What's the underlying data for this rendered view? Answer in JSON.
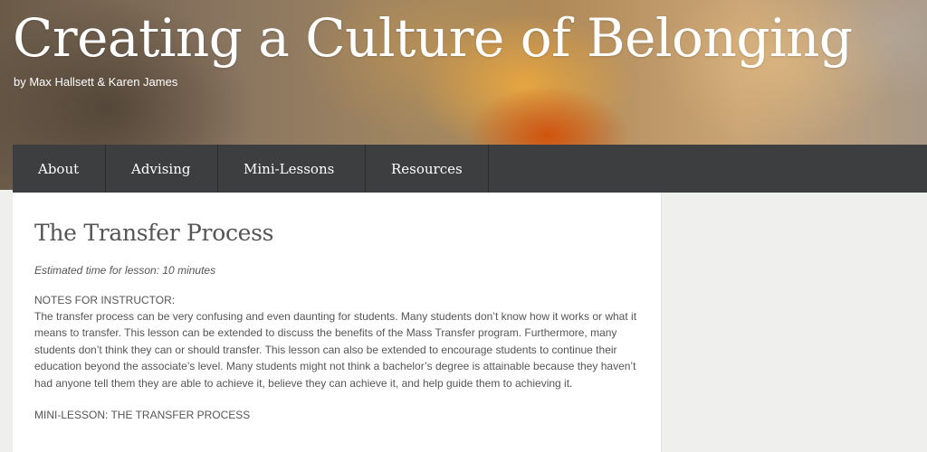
{
  "site": {
    "title": "Creating a Culture of Belonging",
    "byline": "by Max Hallsett & Karen James"
  },
  "nav": {
    "items": [
      {
        "label": "About"
      },
      {
        "label": "Advising"
      },
      {
        "label": "Mini-Lessons"
      },
      {
        "label": "Resources"
      }
    ]
  },
  "post": {
    "title": "The Transfer Process",
    "estimated_time": "Estimated time for lesson: 10 minutes",
    "notes_heading": "NOTES FOR INSTRUCTOR:",
    "notes_body": "The transfer process can be very confusing and even daunting for students. Many students don’t know how it works or what it means to transfer. This lesson can be extended to discuss the benefits of the Mass Transfer program. Furthermore, many students don’t think they can or should transfer. This lesson can also be extended to encourage students to continue their education beyond the associate’s level. Many students might not think a bachelor’s degree is attainable because they haven’t had anyone tell them they are able to achieve it, believe they can achieve it, and help guide them to achieving it.",
    "mini_lesson_heading": "MINI-LESSON: THE TRANSFER PROCESS"
  }
}
